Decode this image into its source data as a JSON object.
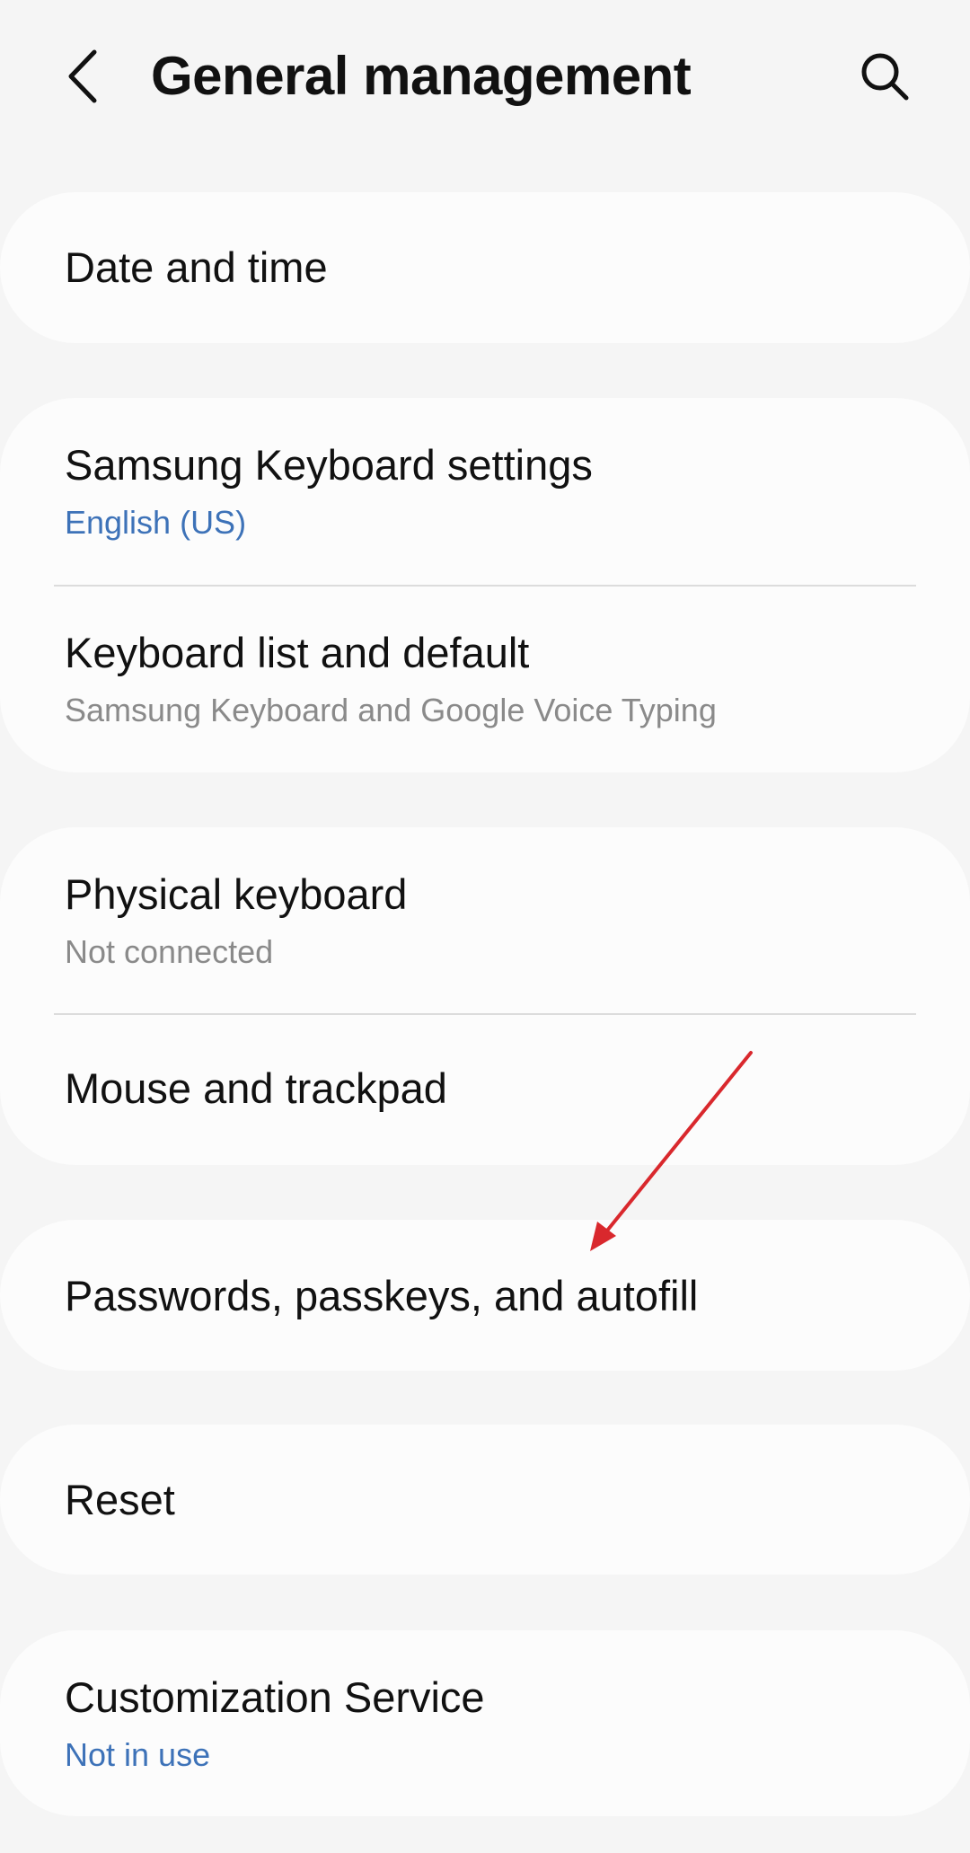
{
  "header": {
    "back_icon": "chevron-left-icon",
    "title": "General management",
    "search_icon": "search-icon"
  },
  "groups": [
    {
      "items": [
        {
          "title": "Date and time"
        }
      ]
    },
    {
      "items": [
        {
          "title": "Samsung Keyboard settings",
          "subtitle": "English (US)",
          "subtitle_color": "#3d72b8"
        },
        {
          "title": "Keyboard list and default",
          "subtitle": "Samsung Keyboard and Google Voice Typing",
          "subtitle_color": "#8a8a8a"
        }
      ]
    },
    {
      "items": [
        {
          "title": "Physical keyboard",
          "subtitle": "Not connected",
          "subtitle_color": "#8a8a8a"
        },
        {
          "title": "Mouse and trackpad"
        }
      ]
    },
    {
      "items": [
        {
          "title": "Passwords, passkeys, and autofill"
        }
      ]
    },
    {
      "items": [
        {
          "title": "Reset"
        }
      ]
    },
    {
      "items": [
        {
          "title": "Customization Service",
          "subtitle": "Not in use",
          "subtitle_color": "#3d72b8"
        }
      ]
    }
  ],
  "annotation": {
    "arrow_color": "#d9282d"
  },
  "colors": {
    "background": "#f5f5f5",
    "card": "#fcfcfc",
    "accent_blue": "#3d72b8",
    "secondary_gray": "#8a8a8a"
  }
}
